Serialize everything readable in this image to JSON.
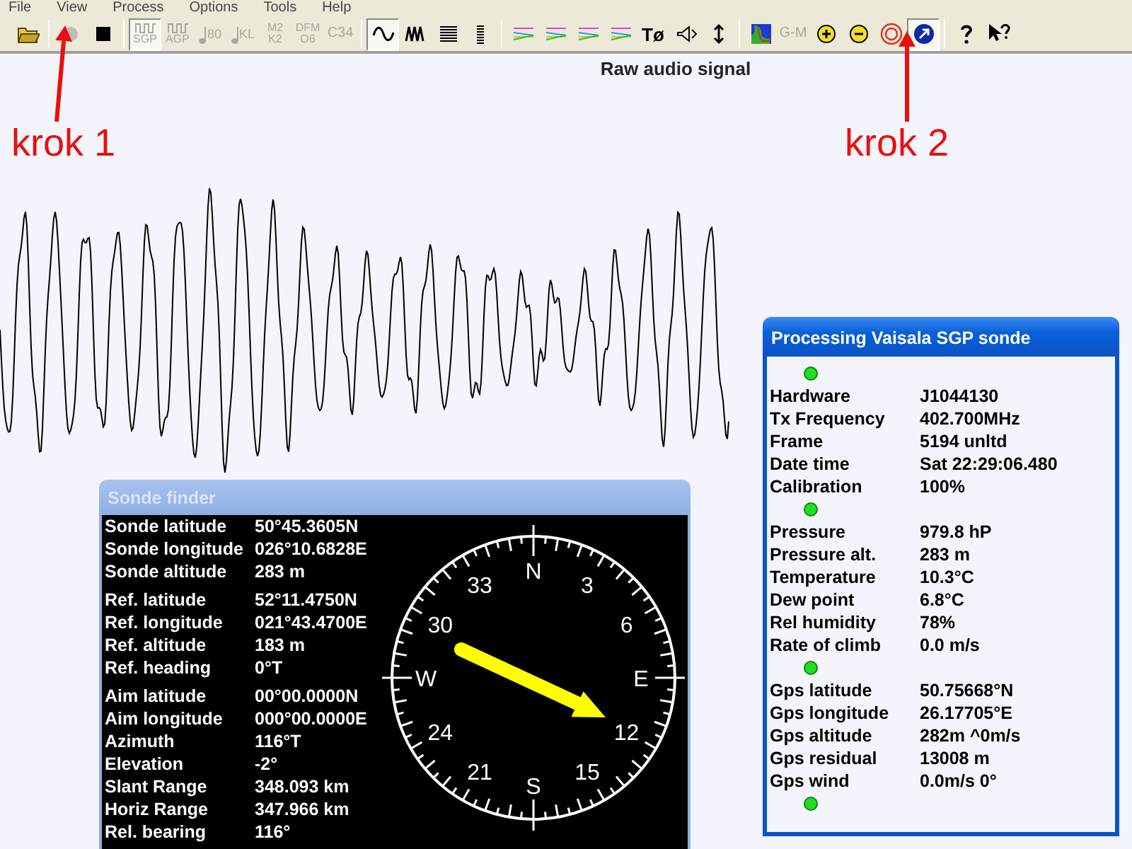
{
  "menu": [
    "File",
    "View",
    "Process",
    "Options",
    "Tools",
    "Help"
  ],
  "toolbar": [
    {
      "kind": "folder",
      "disabled": false,
      "pressed": false
    },
    {
      "kind": "separator"
    },
    {
      "kind": "record",
      "disabled": true,
      "pressed": false
    },
    {
      "kind": "stop",
      "disabled": false,
      "pressed": false
    },
    {
      "kind": "separator"
    },
    {
      "kind": "sonde-wave",
      "lines": [
        "SGP"
      ],
      "disabled": true,
      "pressed": true
    },
    {
      "kind": "sonde-wave",
      "lines": [
        "AGP"
      ],
      "disabled": true,
      "pressed": false
    },
    {
      "kind": "sonde-note",
      "lines": [
        "80"
      ],
      "disabled": true,
      "pressed": false
    },
    {
      "kind": "sonde-note",
      "lines": [
        "KL"
      ],
      "disabled": true,
      "pressed": false
    },
    {
      "kind": "sonde-text",
      "lines": [
        "M2",
        "K2"
      ],
      "disabled": true,
      "pressed": false
    },
    {
      "kind": "sonde-text",
      "lines": [
        "DFM",
        "O6"
      ],
      "disabled": true,
      "pressed": false
    },
    {
      "kind": "sonde-text",
      "lines": [
        "C34"
      ],
      "disabled": true,
      "pressed": false
    },
    {
      "kind": "separator"
    },
    {
      "kind": "sine",
      "disabled": false,
      "pressed": true
    },
    {
      "kind": "wave",
      "disabled": false,
      "pressed": false
    },
    {
      "kind": "bars",
      "disabled": false,
      "pressed": false
    },
    {
      "kind": "bars-thin",
      "disabled": false,
      "pressed": false
    },
    {
      "kind": "separator"
    },
    {
      "kind": "colorlines",
      "disabled": false,
      "pressed": false
    },
    {
      "kind": "colorlines",
      "disabled": false,
      "pressed": false
    },
    {
      "kind": "colorlines",
      "disabled": false,
      "pressed": false
    },
    {
      "kind": "colorlines",
      "disabled": false,
      "pressed": false
    },
    {
      "kind": "sonde-text",
      "lines": [
        "Tø"
      ],
      "disabled": false,
      "pressed": false
    },
    {
      "kind": "speaker",
      "disabled": false,
      "pressed": false
    },
    {
      "kind": "updown",
      "disabled": false,
      "pressed": false
    },
    {
      "kind": "separator"
    },
    {
      "kind": "map",
      "disabled": false,
      "pressed": false
    },
    {
      "kind": "sonde-text",
      "lines": [
        "G-M"
      ],
      "disabled": true,
      "pressed": false
    },
    {
      "kind": "plus",
      "disabled": false,
      "pressed": false
    },
    {
      "kind": "minus",
      "disabled": false,
      "pressed": false
    },
    {
      "kind": "target",
      "disabled": false,
      "pressed": false
    },
    {
      "kind": "arrow",
      "disabled": false,
      "pressed": true
    },
    {
      "kind": "separator"
    },
    {
      "kind": "help",
      "disabled": false,
      "pressed": false
    },
    {
      "kind": "whatsthis",
      "disabled": false,
      "pressed": false
    }
  ],
  "signal_title": "Raw audio signal",
  "annotations": [
    {
      "text": "krok 1"
    },
    {
      "text": "krok 2"
    }
  ],
  "sonde_finder": {
    "title": "Sonde finder",
    "active": false,
    "groups": [
      [
        {
          "label": "Sonde latitude",
          "value": "50°45.3605N"
        },
        {
          "label": "Sonde longitude",
          "value": "026°10.6828E"
        },
        {
          "label": "Sonde altitude",
          "value": "283 m"
        }
      ],
      [
        {
          "label": "Ref. latitude",
          "value": "52°11.4750N"
        },
        {
          "label": "Ref. longitude",
          "value": "021°43.4700E"
        },
        {
          "label": "Ref. altitude",
          "value": "183 m"
        },
        {
          "label": "Ref. heading",
          "value": "0°T"
        }
      ],
      [
        {
          "label": "Aim latitude",
          "value": "00°00.0000N"
        },
        {
          "label": "Aim longitude",
          "value": "000°00.0000E"
        },
        {
          "label": "Azimuth",
          "value": "116°T"
        },
        {
          "label": "Elevation",
          "value": "-2°"
        },
        {
          "label": "Slant Range",
          "value": "348.093 km"
        },
        {
          "label": "Horiz Range",
          "value": "347.966 km"
        },
        {
          "label": "Rel. bearing",
          "value": "116°"
        }
      ]
    ],
    "compass_labels": [
      "N",
      "3",
      "6",
      "E",
      "12",
      "15",
      "S",
      "21",
      "24",
      "W",
      "30",
      "33"
    ]
  },
  "processing": {
    "title": "Processing Vaisala SGP sonde",
    "active": true,
    "items": [
      {
        "kind": "dot",
        "on": true
      },
      {
        "kind": "row",
        "label": "Hardware",
        "value": "J1044130"
      },
      {
        "kind": "row",
        "label": "Tx Frequency",
        "value": "402.700MHz"
      },
      {
        "kind": "row",
        "label": "Frame",
        "value": "5194 unltd"
      },
      {
        "kind": "row",
        "label": "Date time",
        "value": "Sat 22:29:06.480"
      },
      {
        "kind": "row",
        "label": "Calibration",
        "value": "100%"
      },
      {
        "kind": "dot",
        "on": true
      },
      {
        "kind": "row",
        "label": "Pressure",
        "value": "979.8 hP"
      },
      {
        "kind": "row",
        "label": "Pressure alt.",
        "value": "283 m"
      },
      {
        "kind": "row",
        "label": "Temperature",
        "value": "10.3°C"
      },
      {
        "kind": "row",
        "label": "Dew point",
        "value": "6.8°C"
      },
      {
        "kind": "row",
        "label": "Rel humidity",
        "value": "78%"
      },
      {
        "kind": "row",
        "label": "Rate of climb",
        "value": "0.0 m/s"
      },
      {
        "kind": "dot",
        "on": true
      },
      {
        "kind": "row",
        "label": "Gps latitude",
        "value": "50.75668°N"
      },
      {
        "kind": "row",
        "label": "Gps longitude",
        "value": "26.17705°E"
      },
      {
        "kind": "row",
        "label": "Gps altitude",
        "value": "282m ^0m/s"
      },
      {
        "kind": "row",
        "label": "Gps residual",
        "value": "13008 m"
      },
      {
        "kind": "row",
        "label": "Gps wind",
        "value": "0.0m/s 0°"
      },
      {
        "kind": "dot",
        "on": true
      }
    ]
  }
}
